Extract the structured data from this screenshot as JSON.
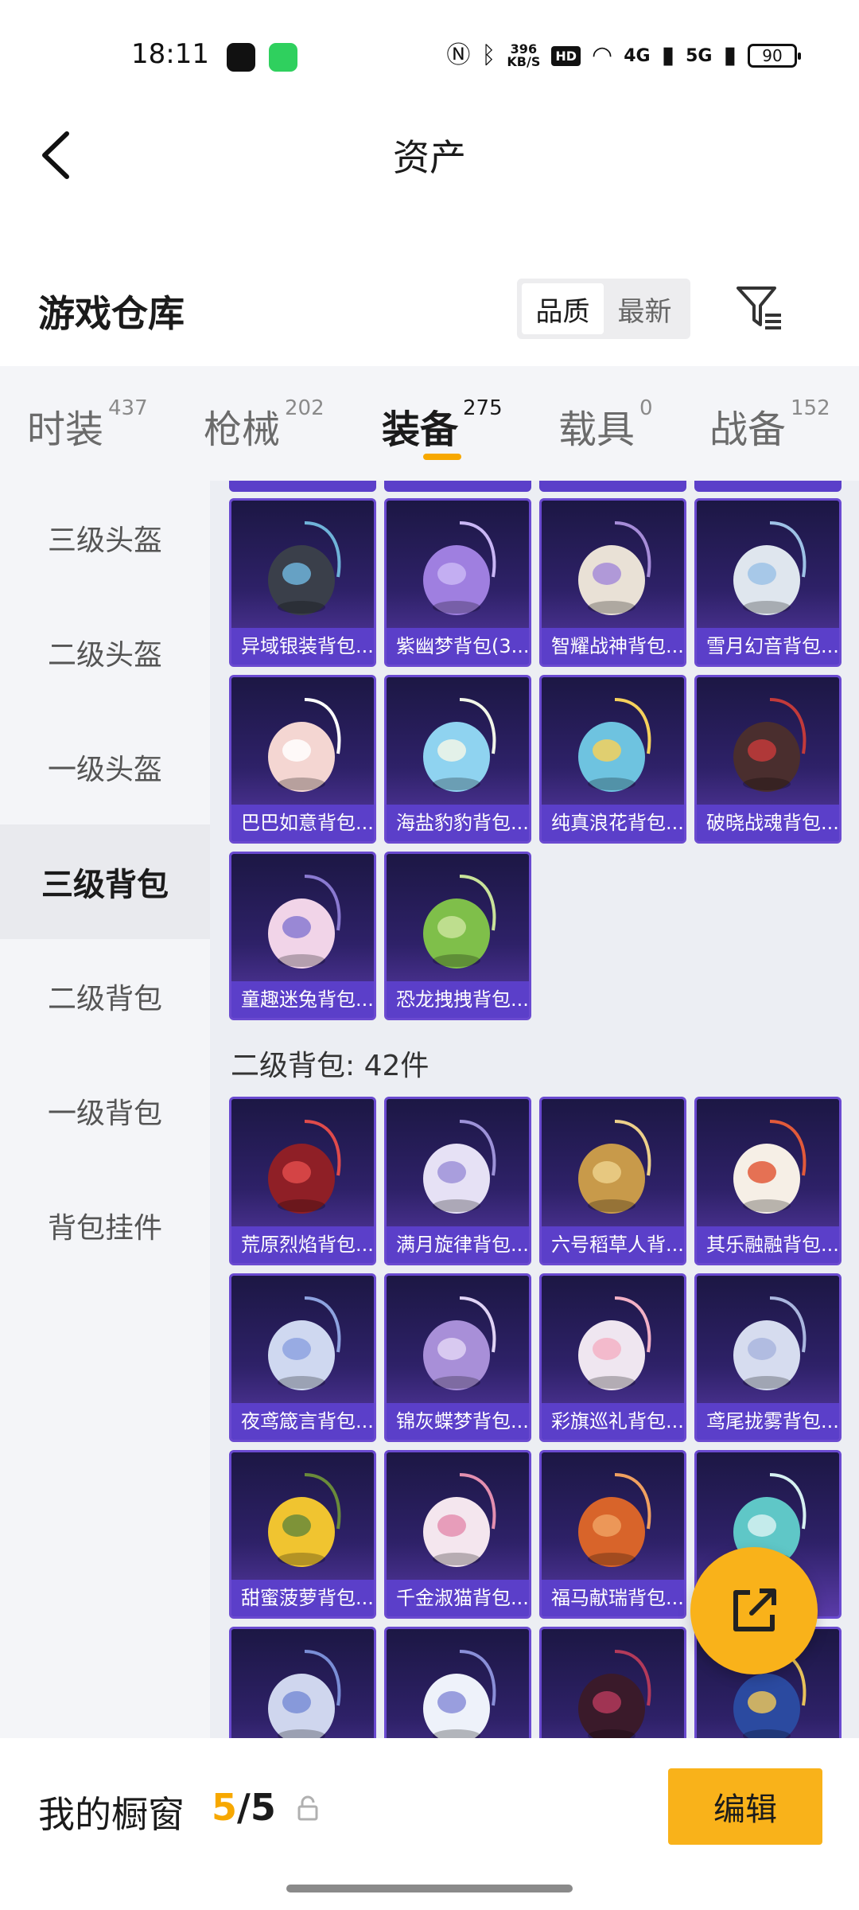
{
  "status_bar": {
    "time": "18:11",
    "net_speed_top": "396",
    "net_speed_unit": "KB/S",
    "hd": "HD",
    "net1": "4G",
    "net2": "5G",
    "battery": "90"
  },
  "header": {
    "title": "资产"
  },
  "warehouse": {
    "title": "游戏仓库",
    "sort_options": [
      "品质",
      "最新"
    ],
    "active_sort": "品质"
  },
  "tabs": [
    {
      "label": "时装",
      "count": "437"
    },
    {
      "label": "枪械",
      "count": "202"
    },
    {
      "label": "装备",
      "count": "275"
    },
    {
      "label": "载具",
      "count": "0"
    },
    {
      "label": "战备",
      "count": "152"
    }
  ],
  "active_tab": "装备",
  "sidebar": {
    "items": [
      "三级头盔",
      "二级头盔",
      "一级头盔",
      "三级背包",
      "二级背包",
      "一级背包",
      "背包挂件"
    ],
    "active": "三级背包"
  },
  "groups": {
    "level3_items": [
      "异域银装背包...",
      "紫幽梦背包(3...",
      "智耀战神背包...",
      "雪月幻音背包...",
      "巴巴如意背包...",
      "海盐豹豹背包...",
      "纯真浪花背包...",
      "破晓战魂背包...",
      "童趣迷兔背包...",
      "恐龙拽拽背包..."
    ],
    "level2_title": "二级背包: 42件",
    "level2_items": [
      "荒原烈焰背包...",
      "满月旋律背包...",
      "六号稻草人背...",
      "其乐融融背包...",
      "夜鸢箴言背包...",
      "锦灰蝶梦背包...",
      "彩旗巡礼背包...",
      "鸢尾拢雾背包...",
      "甜蜜菠萝背包...",
      "千金淑猫背包...",
      "福马献瑞背包...",
      "",
      "",
      "",
      "",
      ""
    ]
  },
  "bottom_bar": {
    "label": "我的橱窗",
    "current": "5",
    "separator": "/",
    "total": "5",
    "edit_label": "编辑"
  },
  "colors": {
    "accent": "#f9b21a",
    "card_label": "#5b3fc9",
    "card_bg": "#2e2168"
  }
}
